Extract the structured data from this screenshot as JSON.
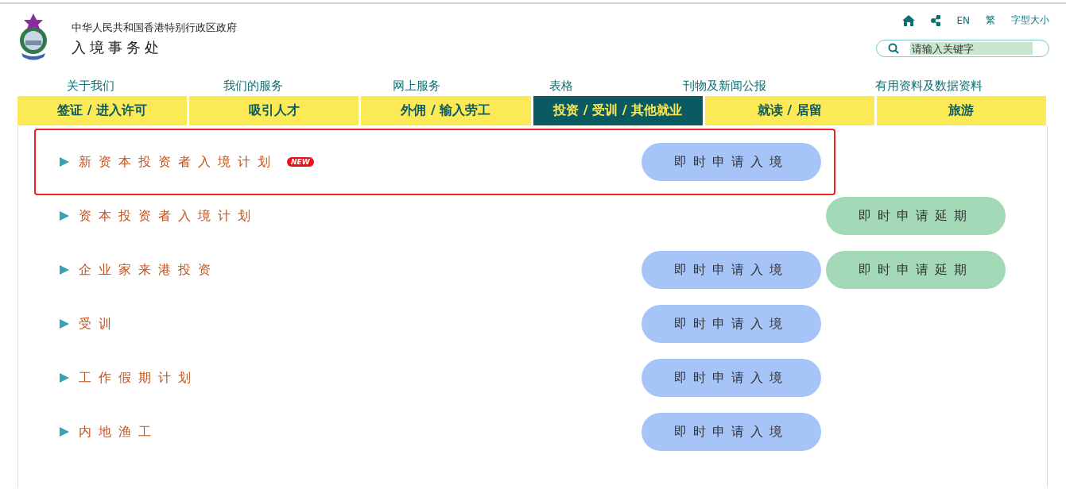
{
  "header": {
    "government": "中华人民共和国香港特别行政区政府",
    "department": "入境事务处"
  },
  "top_links": [
    {
      "kind": "home"
    },
    {
      "kind": "share"
    },
    {
      "kind": "text",
      "label": "EN"
    },
    {
      "kind": "text",
      "label": "繁"
    },
    {
      "kind": "text",
      "label": "字型大小"
    }
  ],
  "search": {
    "placeholder": "请输入关键字"
  },
  "main_nav": [
    "关于我们",
    "我们的服务",
    "网上服务",
    "表格",
    "刊物及新闻公报",
    "有用资料及数据资料"
  ],
  "tabs": [
    {
      "label": "签证 / 进入许可",
      "selected": false
    },
    {
      "label": "吸引人才",
      "selected": false
    },
    {
      "label": "外佣 / 输入劳工",
      "selected": false
    },
    {
      "label": "投资 / 受训 / 其他就业",
      "selected": true
    },
    {
      "label": "就读 / 居留",
      "selected": false
    },
    {
      "label": "旅游",
      "selected": false
    }
  ],
  "schemes": [
    {
      "title": "新资本投资者入境计划",
      "badge": "NEW",
      "highlighted": true,
      "buttons": [
        {
          "kind": "apply",
          "label": "即时申请入境"
        }
      ]
    },
    {
      "title": "资本投资者入境计划",
      "highlighted": false,
      "buttons": [
        {
          "kind": "extend",
          "label": "即时申请延期"
        }
      ]
    },
    {
      "title": "企业家来港投资",
      "highlighted": false,
      "buttons": [
        {
          "kind": "apply",
          "label": "即时申请入境"
        },
        {
          "kind": "extend",
          "label": "即时申请延期"
        }
      ]
    },
    {
      "title": "受训",
      "highlighted": false,
      "buttons": [
        {
          "kind": "apply",
          "label": "即时申请入境"
        }
      ]
    },
    {
      "title": "工作假期计划",
      "highlighted": false,
      "buttons": [
        {
          "kind": "apply",
          "label": "即时申请入境"
        }
      ]
    },
    {
      "title": "内地渔工",
      "highlighted": false,
      "buttons": [
        {
          "kind": "apply",
          "label": "即时申请入境"
        }
      ]
    }
  ]
}
